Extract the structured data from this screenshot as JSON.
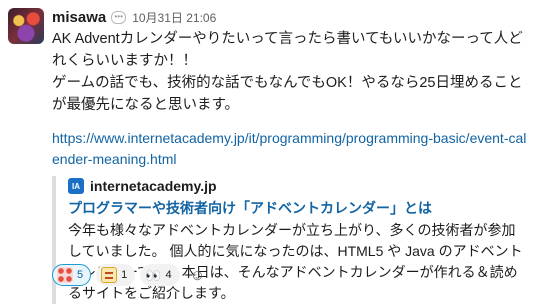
{
  "message": {
    "sender": "misawa",
    "timestamp": "10月31日 21:06",
    "status_icon": "speech-bubble-icon",
    "body_lines": [
      "AK Adventカレンダーやりたいって言ったら書いてもいいかなーって人どれくらいいますか！！",
      "ゲームの話でも、技術的な話でもなんでもOK！やるなら25日埋めることが最優先になると思います。"
    ],
    "link": "https://www.internetacademy.jp/it/programming/programming-basic/event-calender-meaning.html"
  },
  "unfurl": {
    "site_icon_text": "IA",
    "site_name": "internetacademy.jp",
    "title": "プログラマーや技術者向け「アドベントカレンダー」とは",
    "description": "今年も様々なアドベントカレンダーが立ち上がり、多くの技術者が参加していました。 個人的に気になったのは、HTML5 や Java のアドベントカレンダーです。 本日は、そんなアドベントカレンダーが作れる＆読めるサイトをご紹介します。"
  },
  "reactions": [
    {
      "emoji": "dots-emoji",
      "count": "5",
      "selected": true
    },
    {
      "emoji": "badge-emoji",
      "count": "1",
      "selected": false
    },
    {
      "emoji": "👀",
      "count": "4",
      "selected": false
    }
  ],
  "add_reaction_icon": "add-reaction-icon"
}
